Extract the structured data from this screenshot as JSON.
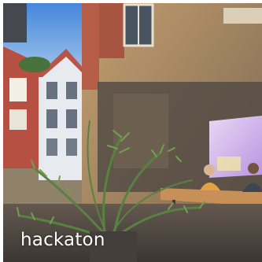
{
  "photo": {
    "subject": "cafe-window-reflection-with-palm-plant",
    "colors": {
      "sky": "#4d8fe0",
      "facade": "#b08a5a",
      "brick": "#b2473a",
      "whiteHouse": "#e8ecf0",
      "palm": "#4f7a36",
      "screen": "#c9a8e6",
      "table": "#c48a4e"
    }
  },
  "caption": {
    "text": "hackaton"
  }
}
